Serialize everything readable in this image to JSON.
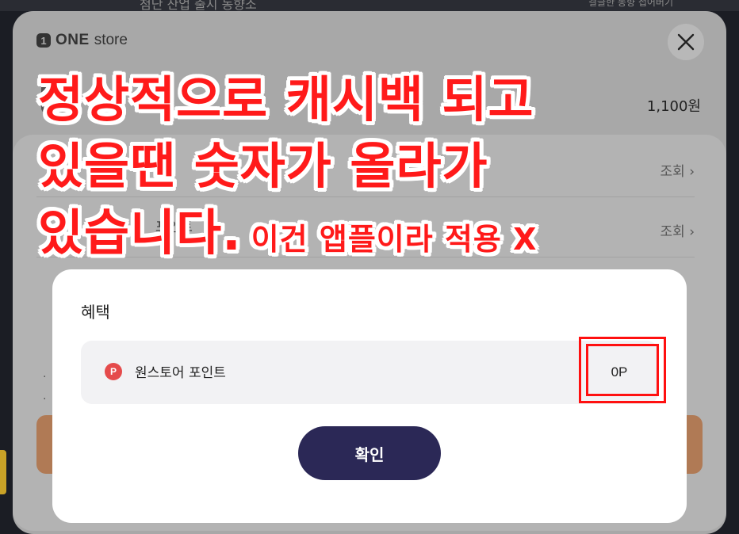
{
  "background": {
    "top_text_left": "첨단 산업 출시 동향소",
    "top_text_right": "결글한 동향 접어버기"
  },
  "sheet": {
    "logo_number": "1",
    "logo_one": "ONE",
    "logo_store": "store",
    "product_price": "1,100원",
    "rows": [
      {
        "label": "",
        "action": "조회"
      },
      {
        "label": "포인트",
        "action": "조회"
      }
    ]
  },
  "modal": {
    "title": "혜택",
    "benefit_label": "원스토어 포인트",
    "benefit_icon": "P",
    "benefit_value": "0P",
    "confirm_label": "확인"
  },
  "annotation": {
    "line1": "정상적으로 캐시백 되고",
    "line2": "있을땐 숫자가 올라가",
    "line3": "있습니다.",
    "line3_small": "이건 앱플이라 적용 X",
    "color": "#ff1a1a"
  }
}
